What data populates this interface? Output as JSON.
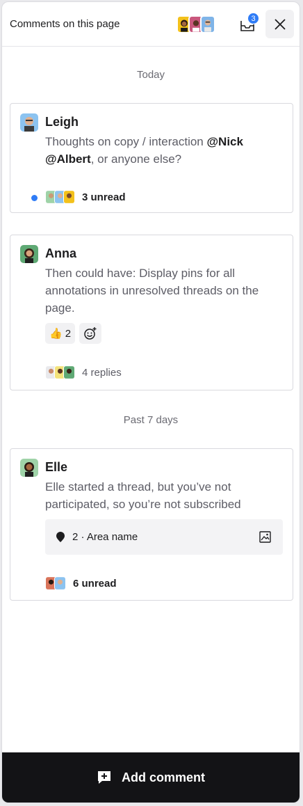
{
  "header": {
    "title": "Comments on this page",
    "inbox_count": "3",
    "avatars": [
      "#f3c11b",
      "#c9577d",
      "#7fb4e8"
    ]
  },
  "sections": {
    "today": "Today",
    "past": "Past 7 days"
  },
  "threads": [
    {
      "author": "Leigh",
      "text_pre": "Thoughts on copy / interaction ",
      "mention": "@Nick @Albert",
      "text_post": ", or anyone else?",
      "meta": "3 unread",
      "avatar_color": "#8cc3f0"
    },
    {
      "author": "Anna",
      "text": "Then could have: Display pins for all annotations in unresolved threads on the page.",
      "reaction_emoji": "👍",
      "reaction_count": "2",
      "meta": "4 replies",
      "avatar_color": "#5fa974"
    },
    {
      "author": "Elle",
      "text": "Elle started a thread, but you’ve not participated, so you’re not subscribed",
      "area": "2 · Area name",
      "meta": "6 unread",
      "avatar_color": "#9fd3a8"
    }
  ],
  "footer": {
    "label": "Add comment"
  },
  "colors": {
    "accent": "#2f7cf6",
    "footer_bg": "#131316"
  }
}
